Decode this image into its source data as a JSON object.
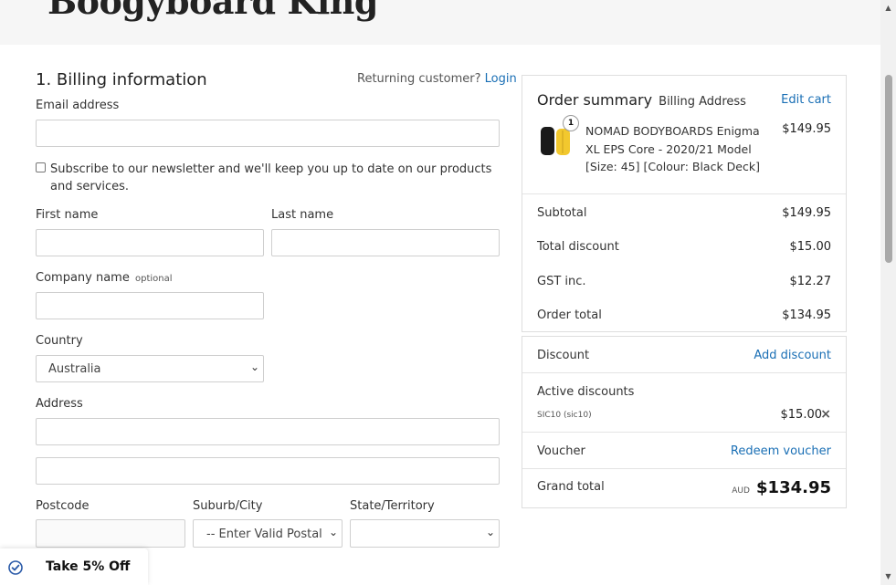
{
  "header": {
    "logo_text": "Boogyboard King"
  },
  "billing": {
    "title": "1. Billing information",
    "returning_text": "Returning customer?",
    "login_link": "Login",
    "email_label": "Email address",
    "email_value": "",
    "newsletter_text": "Subscribe to our newsletter and we'll keep you up to date on our products and services.",
    "newsletter_checked": false,
    "first_name_label": "First name",
    "last_name_label": "Last name",
    "company_label": "Company name",
    "company_optional": "optional",
    "country_label": "Country",
    "country_value": "Australia",
    "address_label": "Address",
    "postcode_label": "Postcode",
    "suburb_label": "Suburb/City",
    "suburb_placeholder": "-- Enter Valid Postal C",
    "state_label": "State/Territory",
    "state_value": ""
  },
  "summary": {
    "title": "Order summary",
    "subtitle": "Billing Address",
    "edit_cart": "Edit cart",
    "item": {
      "quantity": "1",
      "name": "NOMAD BODYBOARDS Enigma XL EPS Core - 2020/21 Model [Size: 45] [Colour: Black Deck]",
      "price": "$149.95",
      "image_icon": "bodyboard-product-image",
      "colors": [
        "#1a1a1a",
        "#f2c82e"
      ]
    },
    "rows": [
      {
        "label": "Subtotal",
        "value": "$149.95"
      },
      {
        "label": "Total discount",
        "value": "$15.00"
      },
      {
        "label": "GST inc.",
        "value": "$12.27"
      },
      {
        "label": "Order total",
        "value": "$134.95"
      }
    ]
  },
  "discount": {
    "label": "Discount",
    "add_link": "Add discount",
    "active_label": "Active discounts",
    "code": "SIC10 (sic10)",
    "amount": "$15.00",
    "remove_icon": "close-icon",
    "voucher_label": "Voucher",
    "redeem_link": "Redeem voucher",
    "grand_total_label": "Grand total",
    "currency": "AUD",
    "grand_total": "$134.95"
  },
  "promo": {
    "text": "Take 5% Off",
    "icon": "check-badge-icon"
  },
  "colors": {
    "link": "#1a6fb5",
    "header_bg": "#f6f6f6",
    "border": "#dedede"
  }
}
